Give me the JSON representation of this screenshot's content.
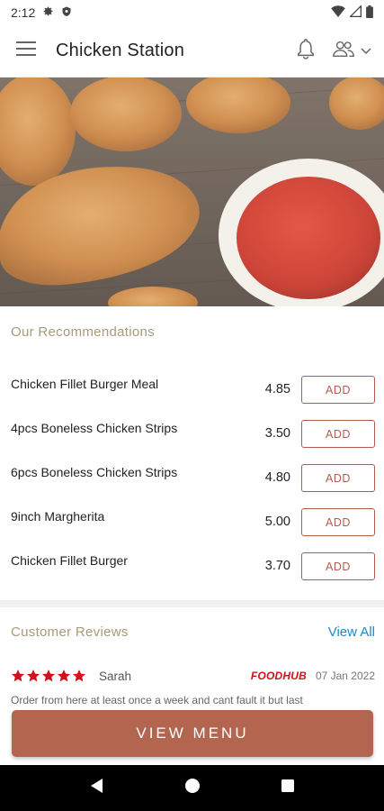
{
  "status_bar": {
    "time": "2:12",
    "left_icons": [
      "gear-icon",
      "shield-icon"
    ],
    "right_icons": [
      "wifi-icon",
      "signal-icon",
      "battery-icon"
    ]
  },
  "app_bar": {
    "title": "Chicken Station",
    "icons": [
      "hamburger-menu-icon",
      "bell-icon",
      "user-group-icon",
      "chevron-down-icon"
    ]
  },
  "hero": {
    "description_icon": "fried-chicken-with-sauce-photo"
  },
  "recommendations": {
    "title": "Our Recommendations",
    "items": [
      {
        "name": "Chicken Fillet Burger Meal",
        "price": "4.85",
        "button": "ADD"
      },
      {
        "name": "4pcs Boneless Chicken Strips",
        "price": "3.50",
        "button": "ADD"
      },
      {
        "name": "6pcs Boneless Chicken Strips",
        "price": "4.80",
        "button": "ADD"
      },
      {
        "name": "9inch Margherita",
        "price": "5.00",
        "button": "ADD"
      },
      {
        "name": "Chicken Fillet Burger",
        "price": "3.70",
        "button": "ADD"
      }
    ]
  },
  "reviews": {
    "title": "Customer Reviews",
    "view_all": "View All",
    "items": [
      {
        "rating": 5,
        "reviewer": "Sarah",
        "source": "FOODHUB",
        "date": "07 Jan 2022",
        "text": "Order from here at least once a week and cant fault it but last"
      }
    ]
  },
  "cta": {
    "label": "VIEW MENU"
  },
  "colors": {
    "accent": "#b35b4e",
    "cta": "#b36550",
    "section_title": "#a89a7a",
    "link": "#1f88c6",
    "star": "#d0101b",
    "brand": "#d0101b"
  }
}
